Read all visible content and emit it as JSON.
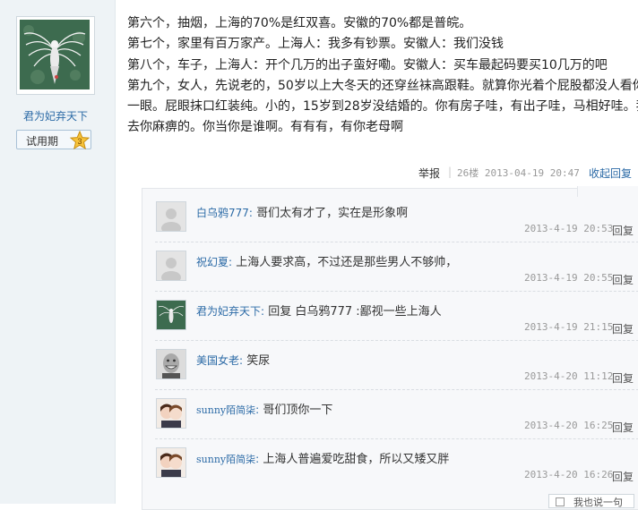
{
  "author": {
    "username": "君为妃弃天下",
    "level_label": "试用期",
    "level_number": "3",
    "avatar_icon": "winged-figure-avatar"
  },
  "post": {
    "lines": [
      "第六个，抽烟，上海的70%是红双喜。安徽的70%都是普皖。",
      "第七个，家里有百万家产。上海人：我多有钞票。安徽人：我们没钱",
      "第八个，车子，上海人：开个几万的出子蛮好嘞。安徽人：买车最起码要买10几万的吧",
      "第九个，女人，先说老的，50岁以上大冬天的还穿丝袜高跟鞋。就算你光着个屁股都没人看你",
      "一眼。屁眼抹口红装纯。小的，15岁到28岁没结婚的。你有房子哇，有出子哇，马相好哇。我",
      "去你麻痹的。你当你是谁啊。有有有，有你老母啊"
    ],
    "report_label": "举报",
    "separator": "|",
    "floor_info": "26楼 2013-04-19 20:47",
    "collapse_label": "收起回复"
  },
  "replies": [
    {
      "user": "白乌鸦777",
      "colon": ":",
      "text": "哥们太有才了，实在是形象啊",
      "time": "2013-4-19 20:53",
      "reply_label": "回复",
      "avatar": "default-avatar"
    },
    {
      "user": "祝幻夏",
      "colon": ":",
      "text": "上海人要求高，不过还是那些男人不够帅，",
      "time": "2013-4-19 20:55",
      "reply_label": "回复",
      "avatar": "default-avatar"
    },
    {
      "user": "君为妃弃天下",
      "colon": ":",
      "text": "回复 白乌鸦777 :鄙视一些上海人",
      "time": "2013-4-19 21:15",
      "reply_label": "回复",
      "avatar": "winged-figure-avatar"
    },
    {
      "user": "美国女老",
      "colon": ":",
      "text": "笑尿",
      "time": "2013-4-20 11:12",
      "reply_label": "回复",
      "avatar": "grinning-man-avatar"
    },
    {
      "user": "sunny陌简柒",
      "colon": ":",
      "text": "哥们顶你一下",
      "time": "2013-4-20 16:25",
      "reply_label": "回复",
      "avatar": "anime-couple-avatar"
    },
    {
      "user": "sunny陌简柒",
      "colon": ":",
      "text": "上海人普遍爱吃甜食，所以又矮又胖",
      "time": "2013-4-20 16:26",
      "reply_label": "回复",
      "avatar": "anime-couple-avatar"
    }
  ],
  "bottom": {
    "label": "我也说一句"
  }
}
